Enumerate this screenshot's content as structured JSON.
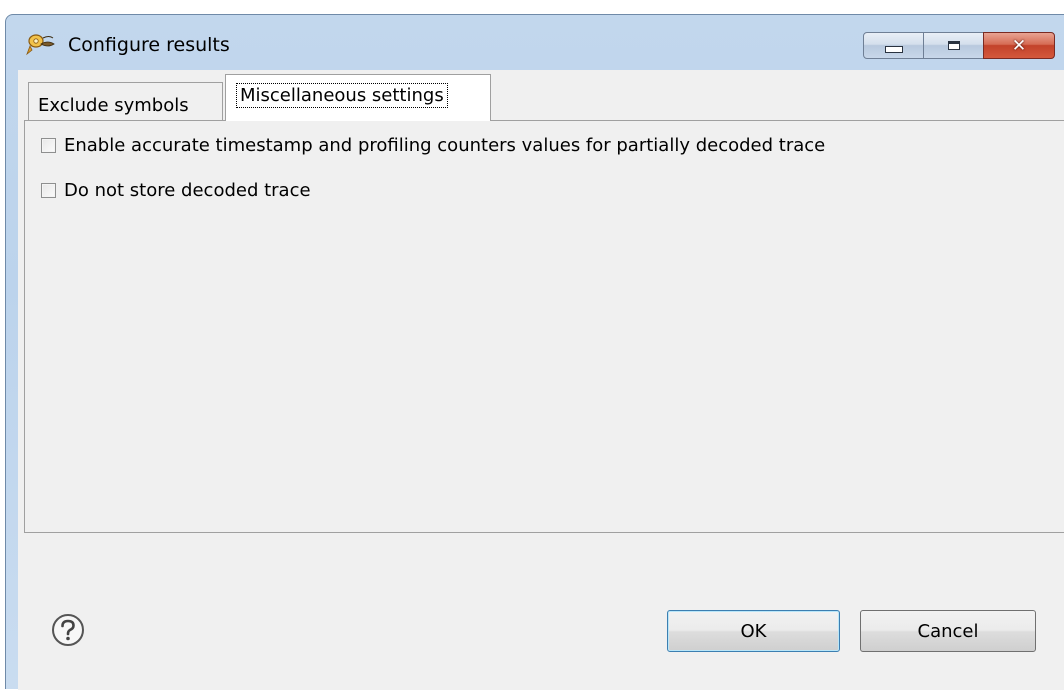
{
  "window": {
    "title": "Configure results",
    "icon": "app-icon",
    "controls": {
      "minimize": "minimize-icon",
      "maximize": "maximize-icon",
      "close": "close-icon",
      "close_glyph": "✕"
    }
  },
  "tabs": [
    {
      "label": "Exclude symbols",
      "active": false
    },
    {
      "label": "Miscellaneous settings",
      "active": true
    }
  ],
  "options": [
    {
      "label": "Enable accurate timestamp and profiling counters values for partially decoded trace",
      "checked": false
    },
    {
      "label": "Do not store decoded trace",
      "checked": false
    }
  ],
  "footer": {
    "help_icon": "help-icon",
    "ok_label": "OK",
    "cancel_label": "Cancel"
  },
  "colors": {
    "frame": "#bcd3ec",
    "client_bg": "#f0f0f0",
    "close_button": "#c2422a",
    "default_button_border": "#3c7fb1"
  }
}
